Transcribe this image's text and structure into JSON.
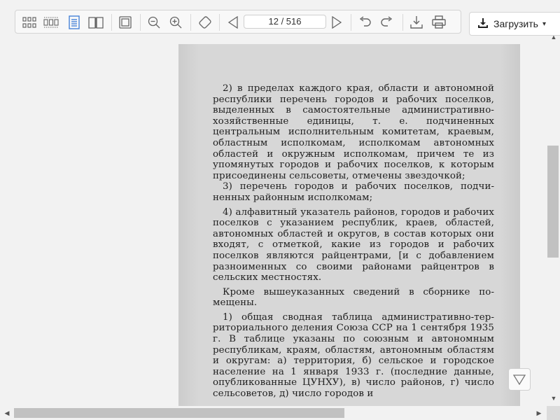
{
  "toolbar": {
    "page_value": "12 / 516",
    "download_label": "Загрузить",
    "icons": [
      "thumbnails-grid-icon",
      "thumbnails-strip-icon",
      "single-page-icon",
      "two-page-icon",
      "fit-page-icon",
      "zoom-out-icon",
      "zoom-in-icon",
      "rotate-tool-icon",
      "prev-page-icon",
      "next-page-icon",
      "undo-icon",
      "redo-icon",
      "download-icon",
      "print-icon"
    ]
  },
  "document": {
    "paragraphs": [
      "2) в пределах каждого края, области и автоном­ной республики перечень городов и рабочих посел­ков, выделенных в самостоятельные административно-хозяйственные единицы, т. е. подчиненных центральным исполнительным комитетам, краевым, областным исполкомам, исполкомам автономных областей и окружным исполкомам, причем те из упомянутых городов и рабочих поселков, к кото­рым присоединены сельсоветы, отмечены звездоч­кой;",
      "3) перечень городов и рабочих поселков, подчи­ненных районным исполкомам;",
      "4) алфавитный указатель районов, городов и ра­бочих поселков с указанием республик, краев, областей, автономных областей и округов, в состав которых они входят, с отметкой, какие из городов и рабочих поселков являются райцентрами, [и с добавлением разноименных со своими районами райцентров в сельских местностях.",
      "Кроме вышеуказанных сведений в сборнике по­мещены.",
      "1) общая сводная таблица административно-тер­риториального деления Союза ССР на 1 сентября 1935 г. В таблице указаны по союзным и автоном­ным республикам, краям, областям, автономным областям и округам: а) территория, б) сельское и городское население на 1 января 1933 г. (послед­ние данные, опубликованные ЦУНХУ), в) число районов, г) число сельсоветов, д) число городов и"
    ]
  },
  "colors": {
    "toolbar_bg": "#f8f8f8",
    "page_bg": "#d7d7d7",
    "single_page_active": "#3a7bd5"
  }
}
